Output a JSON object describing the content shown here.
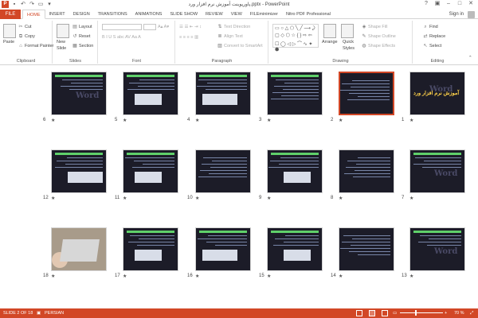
{
  "title_bar": {
    "app_icon": "P",
    "doc_title": "پاورپوینت آموزش نرم افزار ورد.pptx - PowerPoint",
    "help": "?"
  },
  "tabs": {
    "file": "FILE",
    "items": [
      "HOME",
      "INSERT",
      "DESIGN",
      "TRANSITIONS",
      "ANIMATIONS",
      "SLIDE SHOW",
      "REVIEW",
      "VIEW",
      "FILEminimizer",
      "Nitro PDF Professional"
    ],
    "active": "HOME",
    "sign_in": "Sign in"
  },
  "ribbon": {
    "clipboard": {
      "paste": "Paste",
      "cut": "Cut",
      "copy": "Copy",
      "format_painter": "Format Painter",
      "label": "Clipboard"
    },
    "slides": {
      "new_slide": "New",
      "new_slide_2": "Slide",
      "layout": "Layout",
      "reset": "Reset",
      "section": "Section",
      "label": "Slides"
    },
    "font": {
      "label": "Font"
    },
    "paragraph": {
      "text_direction": "Text Direction",
      "align_text": "Align Text",
      "convert_smartart": "Convert to SmartArt",
      "label": "Paragraph"
    },
    "drawing": {
      "arrange": "Arrange",
      "quick_styles": "Quick",
      "quick_styles_2": "Styles",
      "shape_fill": "Shape Fill",
      "shape_outline": "Shape Outline",
      "shape_effects": "Shape Effects",
      "label": "Drawing"
    },
    "editing": {
      "find": "Find",
      "replace": "Replace",
      "select": "Select",
      "label": "Editing"
    }
  },
  "slides": [
    {
      "num": "1",
      "kind": "title",
      "title_text": "آموزش نرم افزار ورد",
      "selected": false
    },
    {
      "num": "2",
      "kind": "text",
      "selected": true
    },
    {
      "num": "3",
      "kind": "text"
    },
    {
      "num": "4",
      "kind": "panel"
    },
    {
      "num": "5",
      "kind": "panel"
    },
    {
      "num": "6",
      "kind": "wordlogo"
    },
    {
      "num": "7",
      "kind": "wordlogo"
    },
    {
      "num": "8",
      "kind": "text"
    },
    {
      "num": "9",
      "kind": "panel"
    },
    {
      "num": "10",
      "kind": "text"
    },
    {
      "num": "11",
      "kind": "panel"
    },
    {
      "num": "12",
      "kind": "panel"
    },
    {
      "num": "13",
      "kind": "wordlogo"
    },
    {
      "num": "14",
      "kind": "text"
    },
    {
      "num": "15",
      "kind": "panel"
    },
    {
      "num": "16",
      "kind": "panel"
    },
    {
      "num": "17",
      "kind": "panel"
    },
    {
      "num": "18",
      "kind": "photo"
    }
  ],
  "status_bar": {
    "slide_info": "SLIDE 2 OF 18",
    "language": "PERSIAN",
    "zoom": "70 %",
    "zoom_level": 0.7
  }
}
